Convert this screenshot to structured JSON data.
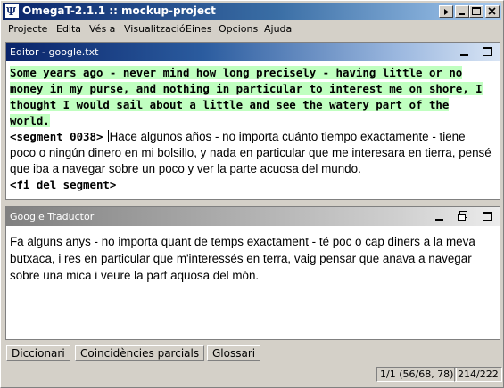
{
  "window": {
    "title": "OmegaT-2.1.1 :: mockup-project",
    "colors": {
      "titlebar_start": "#0a246a",
      "titlebar_end": "#a6caf0",
      "source_highlight": "#c0ffc0"
    }
  },
  "menu": {
    "items": [
      "Projecte",
      "Edita",
      "Vés a",
      "Visualització",
      "Eines",
      "Opcions",
      "Ajuda"
    ]
  },
  "editor_pane": {
    "title": "Editor - google.txt",
    "source_text": "Some years ago - never mind how long precisely - having little or no money in my purse, and nothing in particular to interest me on shore, I thought I would sail about a little and see the watery part of the world.",
    "segment_open_tag": "<segment 0038>",
    "target_text": "Hace algunos años - no importa cuánto tiempo exactamente - tiene poco o ningún dinero en mi bolsillo, y nada en particular que me interesara en tierra, pensé que iba a navegar sobre un poco y ver la parte acuosa del mundo.",
    "segment_close_tag": "<fi del segment>"
  },
  "mt_pane": {
    "title": "Google Traductor",
    "text": "Fa alguns anys - no importa quant de temps exactament - té poc o cap diners a la meva butxaca, i res en particular que m'interessés en terra, vaig pensar que anava a navegar sobre una mica i veure la part aquosa del món."
  },
  "bottom_tabs": [
    "Diccionari",
    "Coincidències parcials",
    "Glossari"
  ],
  "status_bar": {
    "progress": "1/1 (56/68, 78)",
    "segments": "214/222"
  },
  "icons": {
    "app": "omegat-app-icon",
    "title_buttons": [
      "restore-icon",
      "minimize-icon",
      "maximize-icon",
      "close-icon"
    ],
    "editor_buttons": [
      "minimize-pane-icon",
      "maximize-pane-icon"
    ],
    "mt_buttons": [
      "minimize-pane-icon",
      "undock-pane-icon",
      "maximize-pane-icon"
    ]
  }
}
